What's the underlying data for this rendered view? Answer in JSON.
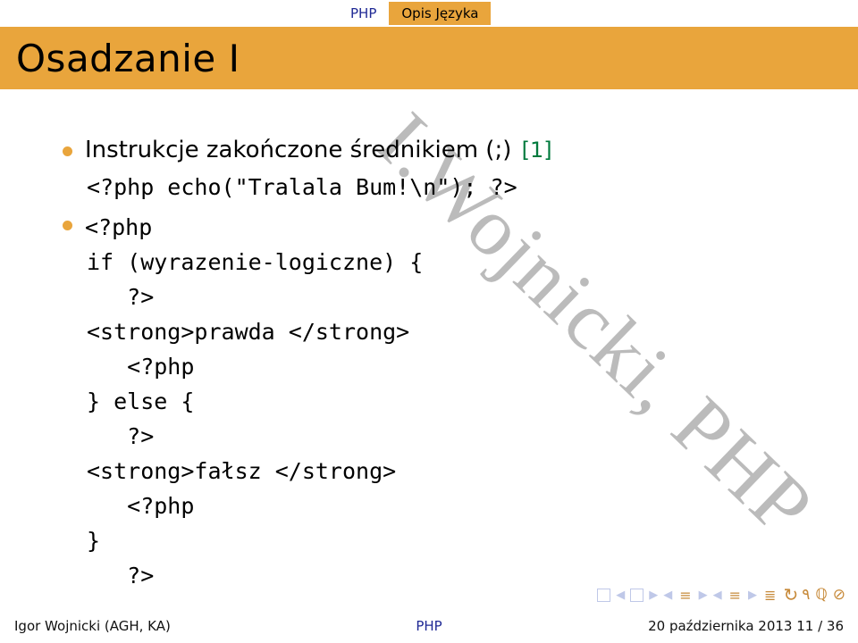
{
  "tabs": {
    "left": "PHP",
    "active": "Opis Języka"
  },
  "title": "Osadzanie I",
  "bullets": {
    "b1_text": "Instrukcje zakończone średnikiem (;)",
    "b1_ref": "[1]"
  },
  "code": {
    "line1": "<?php echo(\"Tralala Bum!\\n\"); ?>",
    "line2": "<?php",
    "line3": "if (wyrazenie-logiczne) {",
    "line4": "   ?>",
    "line5": "<strong>prawda </strong>",
    "line6": "   <?php",
    "line7": "} else {",
    "line8": "   ?>",
    "line9": "<strong>fałsz </strong>",
    "line10": "   <?php",
    "line11": "}",
    "line12": "   ?>"
  },
  "watermark": "I.Wojnicki, PHP",
  "footer": {
    "left": "Igor Wojnicki (AGH, KA)",
    "center": "PHP",
    "right": "20 października 2013    11 / 36"
  }
}
